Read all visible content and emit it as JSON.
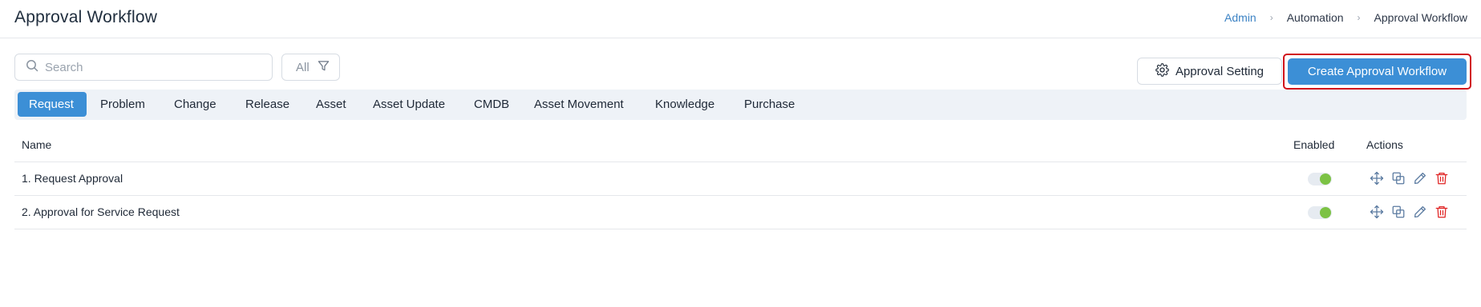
{
  "header": {
    "title": "Approval Workflow",
    "breadcrumb": [
      "Admin",
      "Automation",
      "Approval Workflow"
    ]
  },
  "toolbar": {
    "search_placeholder": "Search",
    "filter_label": "All",
    "approval_setting_label": "Approval Setting",
    "create_label": "Create Approval Workflow"
  },
  "tabs": [
    {
      "label": "Request",
      "active": true
    },
    {
      "label": "Problem"
    },
    {
      "label": "Change"
    },
    {
      "label": "Release"
    },
    {
      "label": "Asset"
    },
    {
      "label": "Asset Update"
    },
    {
      "label": "CMDB"
    },
    {
      "label": "Asset Movement"
    },
    {
      "label": "Knowledge"
    },
    {
      "label": "Purchase"
    }
  ],
  "table": {
    "columns": [
      "Name",
      "Enabled",
      "Actions"
    ],
    "rows": [
      {
        "name": "1. Request Approval",
        "enabled": true
      },
      {
        "name": "2. Approval for Service Request",
        "enabled": true
      }
    ]
  },
  "colors": {
    "accent": "#3c8fd6",
    "highlight_border": "#d0121b",
    "toggle_on": "#7cc244",
    "delete": "#e02424"
  }
}
